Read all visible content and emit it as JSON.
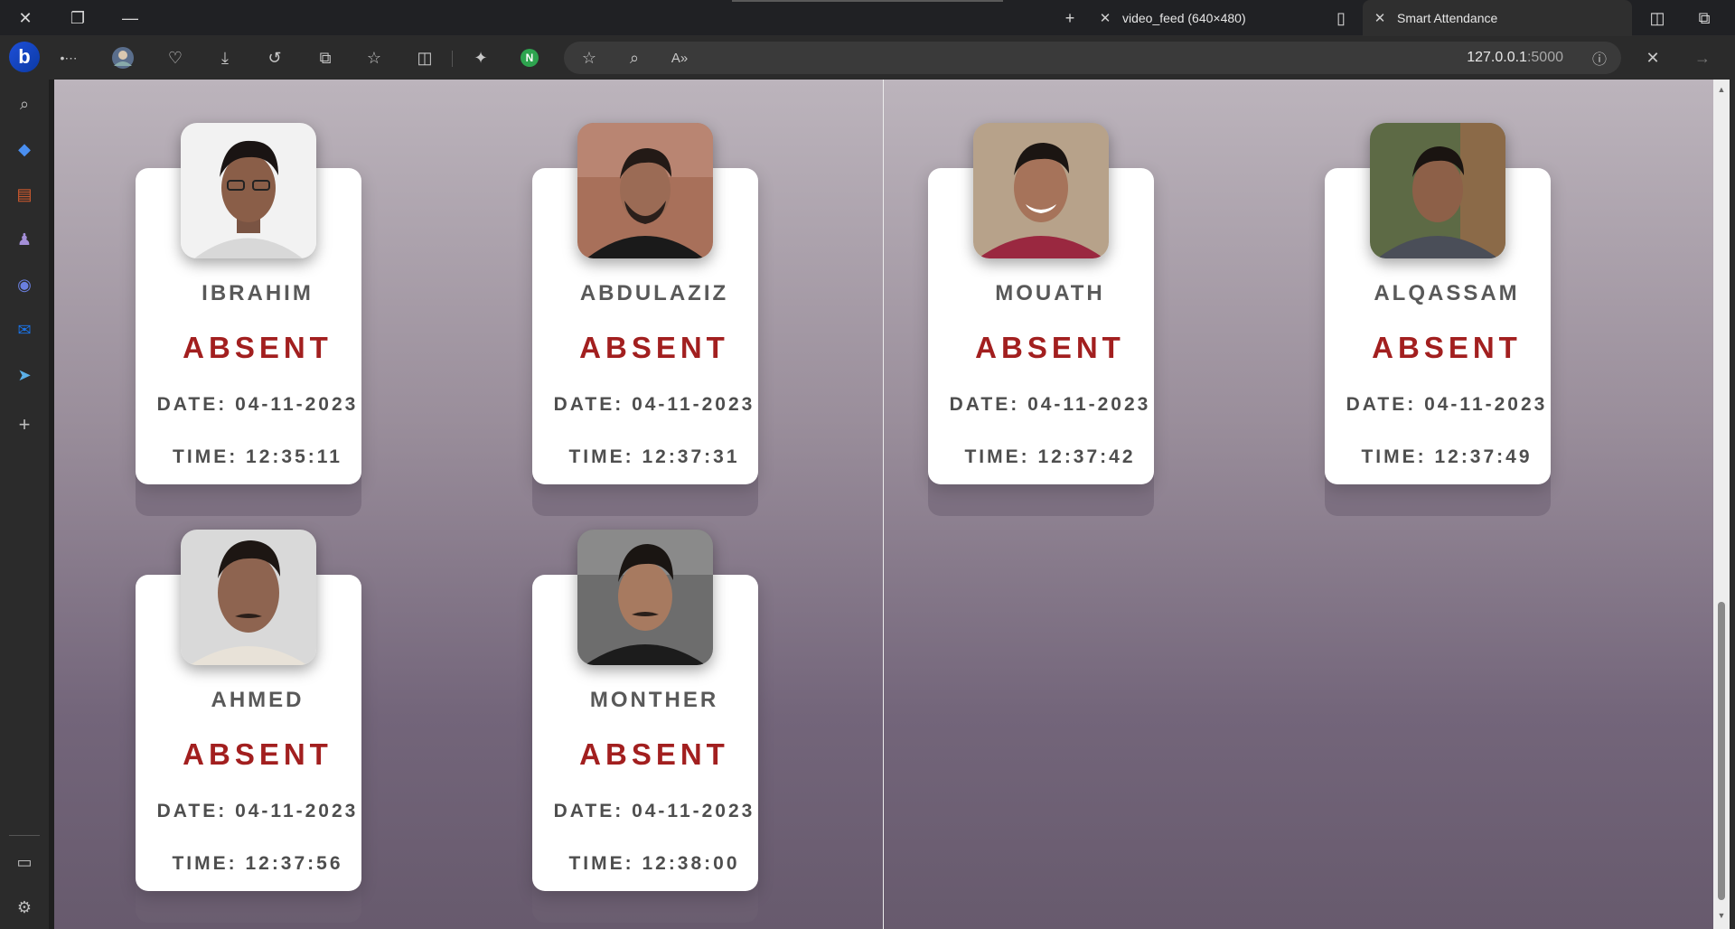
{
  "window": {
    "tabs": [
      {
        "title": "video_feed (640×480)",
        "active": false
      },
      {
        "title": "Smart Attendance",
        "active": true
      }
    ]
  },
  "toolbar": {
    "url_host": "127.0.0.1",
    "url_port": ":5000",
    "extension_badge": "N"
  },
  "sidebar": {
    "logo": "b"
  },
  "attendance": {
    "cards": [
      {
        "name": "IBRAHIM",
        "status": "ABSENT",
        "date": "DATE: 04-11-2023",
        "time": "TIME: 12:35:11"
      },
      {
        "name": "ABDULAZIZ",
        "status": "ABSENT",
        "date": "DATE: 04-11-2023",
        "time": "TIME: 12:37:31"
      },
      {
        "name": "MOUATH",
        "status": "ABSENT",
        "date": "DATE: 04-11-2023",
        "time": "TIME: 12:37:42"
      },
      {
        "name": "ALQASSAM",
        "status": "ABSENT",
        "date": "DATE: 04-11-2023",
        "time": "TIME: 12:37:49"
      },
      {
        "name": "AHMED",
        "status": "ABSENT",
        "date": "DATE: 04-11-2023",
        "time": "TIME: 12:37:56"
      },
      {
        "name": "MONTHER",
        "status": "ABSENT",
        "date": "DATE: 04-11-2023",
        "time": "TIME: 12:38:00"
      }
    ]
  },
  "colors": {
    "status_absent": "#a21f1f",
    "card_bg": "#ffffff"
  }
}
